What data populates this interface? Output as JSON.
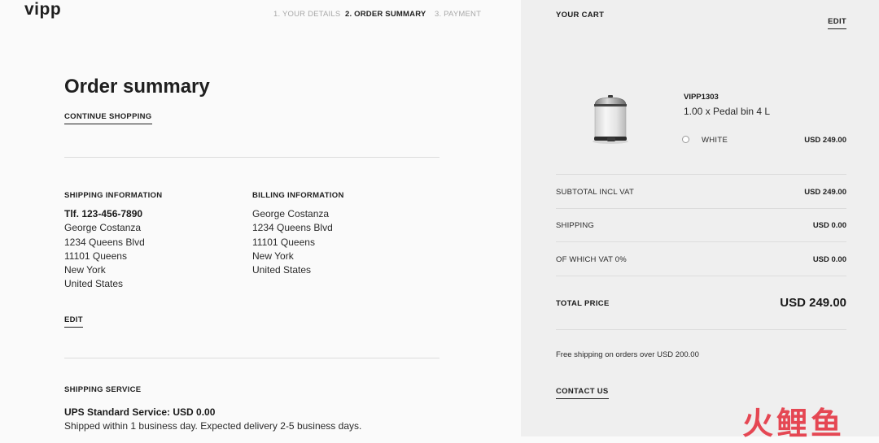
{
  "brand": {
    "logo": "vipp"
  },
  "checkout_steps": [
    {
      "label": "1. YOUR DETAILS",
      "active": false
    },
    {
      "label": "2. ORDER SUMMARY",
      "active": true
    },
    {
      "label": "3. PAYMENT",
      "active": false
    }
  ],
  "summary": {
    "title": "Order summary",
    "continue_label": "CONTINUE SHOPPING",
    "shipping_info": {
      "heading": "SHIPPING INFORMATION",
      "lines": [
        "Tlf. 123-456-7890",
        "George Costanza",
        "1234 Queens Blvd",
        "11101 Queens",
        "New York",
        "United States"
      ]
    },
    "billing_info": {
      "heading": "BILLING INFORMATION",
      "lines": [
        "George Costanza",
        "1234 Queens Blvd",
        "11101 Queens",
        "New York",
        "United States"
      ]
    },
    "edit_label": "EDIT",
    "shipping_service": {
      "heading": "SHIPPING SERVICE",
      "service": "UPS Standard Service: USD 0.00",
      "description": "Shipped within 1 business day. Expected delivery 2-5 business days."
    }
  },
  "cart": {
    "title": "YOUR CART",
    "edit_label": "EDIT",
    "item": {
      "sku": "VIPP1303",
      "name": "1.00 x Pedal bin 4 L",
      "color": "WHITE",
      "price": "USD 249.00",
      "icon": "pedal-bin-image"
    },
    "rows": [
      {
        "label": "SUBTOTAL INCL VAT",
        "value": "USD 249.00"
      },
      {
        "label": "SHIPPING",
        "value": "USD 0.00"
      },
      {
        "label": "OF WHICH VAT 0%",
        "value": "USD 0.00"
      }
    ],
    "total": {
      "label": "TOTAL PRICE",
      "value": "USD 249.00"
    },
    "free_shipping_note": "Free shipping on orders over USD 200.00",
    "contact_label": "CONTACT US"
  },
  "watermark": {
    "text": "火鲤鱼",
    "color": "#e53946"
  },
  "colors": {
    "left_bg": "#fafafa",
    "right_bg": "#efefef",
    "text": "#1f1f1f",
    "muted": "#a8a8a8"
  }
}
